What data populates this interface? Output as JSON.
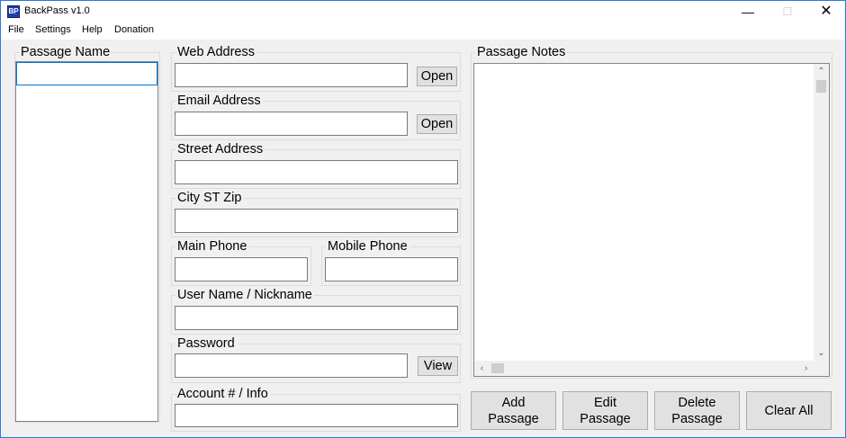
{
  "window": {
    "title": "BackPass v1.0",
    "icon": "app-icon",
    "icon_text": "BP"
  },
  "controls": {
    "minimize": "—",
    "maximize": "☐",
    "close": "✕"
  },
  "menu": [
    "File",
    "Settings",
    "Help",
    "Donation"
  ],
  "passage_list": {
    "label": "Passage Name",
    "items": []
  },
  "fields": {
    "web_address": {
      "label": "Web Address",
      "value": "",
      "button": "Open"
    },
    "email_address": {
      "label": "Email Address",
      "value": "",
      "button": "Open"
    },
    "street_address": {
      "label": "Street Address",
      "value": ""
    },
    "city_st_zip": {
      "label": "City ST Zip",
      "value": ""
    },
    "main_phone": {
      "label": "Main Phone",
      "value": ""
    },
    "mobile_phone": {
      "label": "Mobile Phone",
      "value": ""
    },
    "user_name": {
      "label": "User Name / Nickname",
      "value": ""
    },
    "password": {
      "label": "Password",
      "value": "",
      "button": "View"
    },
    "account_info": {
      "label": "Account # / Info",
      "value": ""
    }
  },
  "notes": {
    "label": "Passage Notes",
    "value": ""
  },
  "actions": {
    "add_line1": "Add",
    "add_line2": "Passage",
    "edit_line1": "Edit",
    "edit_line2": "Passage",
    "delete_line1": "Delete",
    "delete_line2": "Passage",
    "clear": "Clear All"
  },
  "colors": {
    "accent": "#0078d7",
    "window_border": "#2b79d8",
    "face": "#f0f0f0"
  }
}
